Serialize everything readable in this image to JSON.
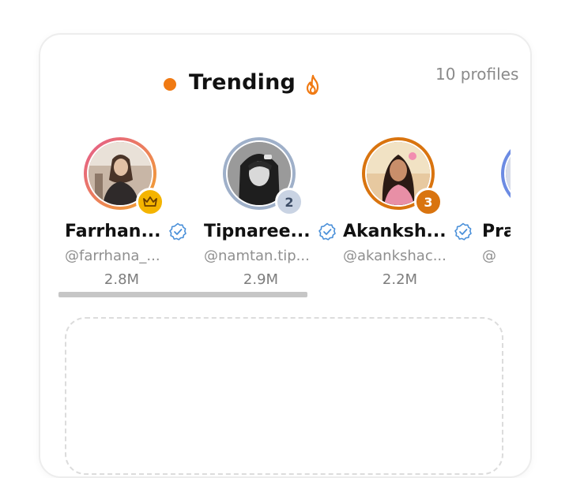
{
  "header": {
    "title": "Trending",
    "dot_color": "#f07a13",
    "fire_icon": "fire-icon",
    "count_text": "10 profiles"
  },
  "profiles": [
    {
      "name": "Farrhan...",
      "handle": "@farrhana_...",
      "followers": "2.8M",
      "badge": "crown",
      "badge_color": "#f4b400"
    },
    {
      "name": "Tipnaree...",
      "handle": "@namtan.tip...",
      "followers": "2.9M",
      "badge": "2",
      "badge_color": "#c9d3e3"
    },
    {
      "name": "Akanksh...",
      "handle": "@akankshac...",
      "followers": "2.2M",
      "badge": "3",
      "badge_color": "#d9740f"
    },
    {
      "name": "Pra",
      "handle": "@",
      "followers": "",
      "badge": "",
      "badge_color": ""
    }
  ],
  "colors": {
    "accent": "#f07a13",
    "verified": "#4a90d9"
  }
}
